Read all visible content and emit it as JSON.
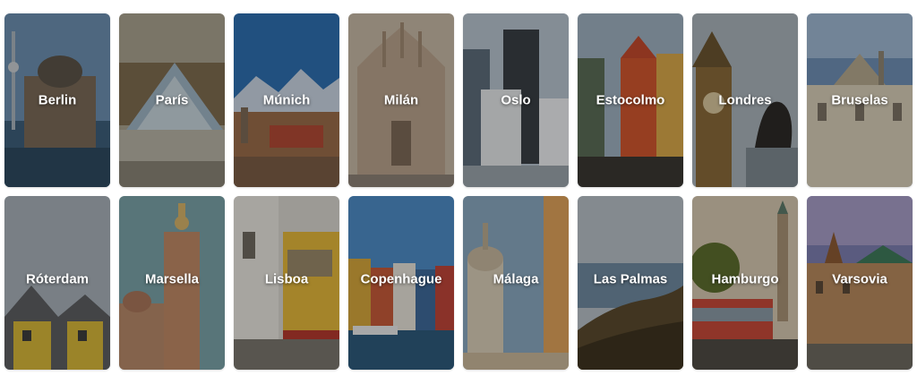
{
  "cities": [
    {
      "name": "Berlin"
    },
    {
      "name": "París"
    },
    {
      "name": "Múnich"
    },
    {
      "name": "Milán"
    },
    {
      "name": "Oslo"
    },
    {
      "name": "Estocolmo"
    },
    {
      "name": "Londres"
    },
    {
      "name": "Bruselas"
    },
    {
      "name": "Róterdam"
    },
    {
      "name": "Marsella"
    },
    {
      "name": "Lisboa"
    },
    {
      "name": "Copenhague"
    },
    {
      "name": "Málaga"
    },
    {
      "name": "Las Palmas"
    },
    {
      "name": "Hamburgo"
    },
    {
      "name": "Varsovia"
    }
  ]
}
